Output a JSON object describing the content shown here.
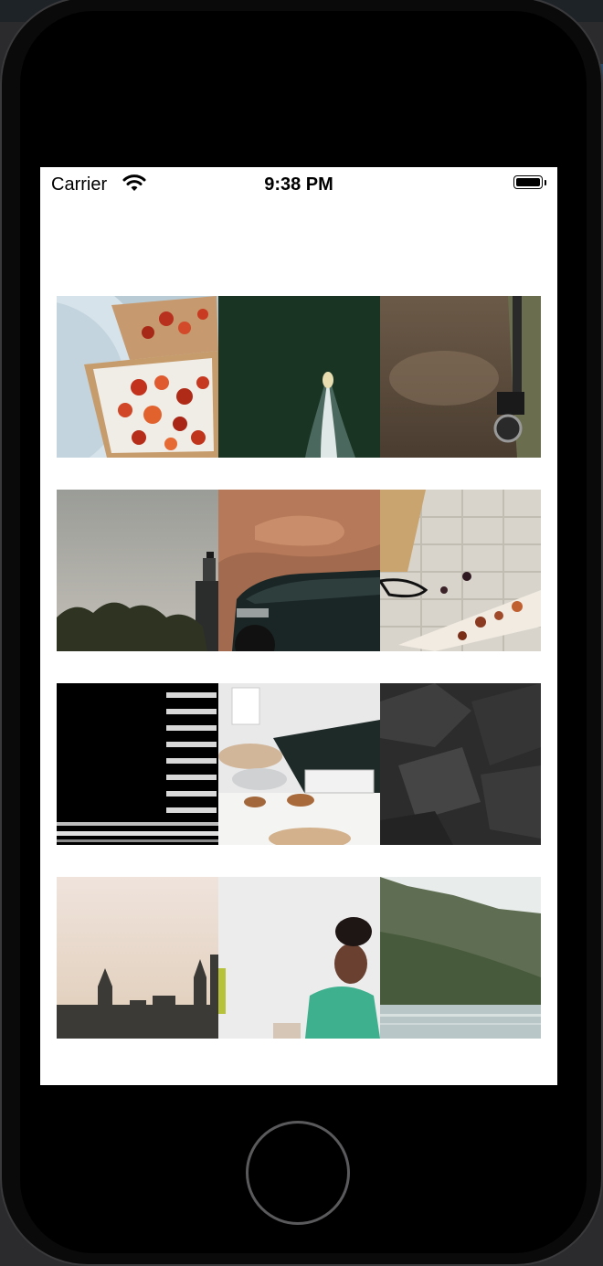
{
  "status_bar": {
    "carrier": "Carrier",
    "time": "9:38 PM",
    "wifi_icon": "wifi-icon",
    "battery_icon": "battery-icon"
  },
  "gallery": {
    "rows": [
      [
        "pomegranate-toast-photo",
        "jet-ski-aerial-photo",
        "camera-strap-photo"
      ],
      [
        "lighthouse-dusk-photo",
        "car-desert-photo",
        "chocolate-bark-photo"
      ],
      [
        "striped-abstract-photo",
        "kitchen-counter-photo",
        "dark-rock-photo"
      ],
      [
        "city-skyline-photo",
        "laughing-woman-photo",
        "mountain-lake-photo"
      ]
    ]
  },
  "hardware": {
    "home_button": "home-button"
  }
}
